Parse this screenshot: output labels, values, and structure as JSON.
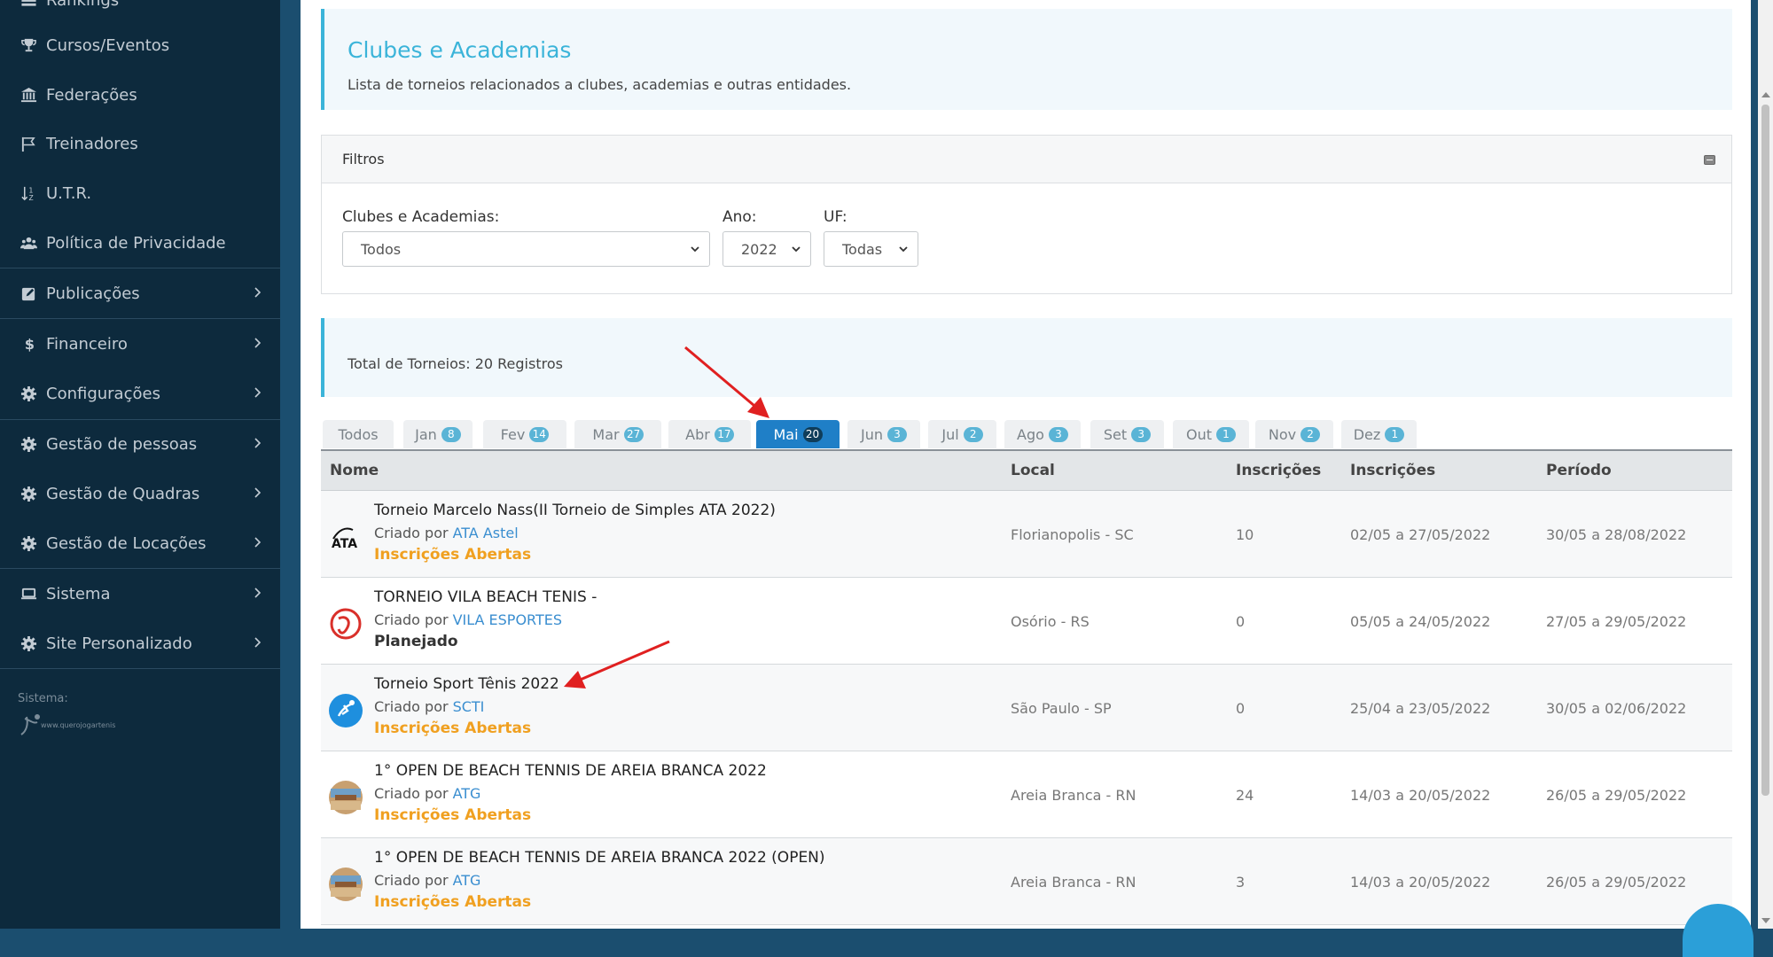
{
  "sidebar": {
    "items": [
      {
        "label": "Rankings",
        "icon": "list-icon"
      },
      {
        "label": "Cursos/Eventos",
        "icon": "trophy-icon"
      },
      {
        "label": "Federações",
        "icon": "bank-icon"
      },
      {
        "label": "Treinadores",
        "icon": "flag-icon"
      },
      {
        "label": "U.T.R.",
        "icon": "sort-icon"
      },
      {
        "label": "Política de Privacidade",
        "icon": "users-icon"
      },
      {
        "label": "Publicações",
        "icon": "edit-icon"
      },
      {
        "label": "Financeiro",
        "icon": "dollar-icon"
      },
      {
        "label": "Configurações",
        "icon": "gear-icon"
      },
      {
        "label": "Gestão de pessoas",
        "icon": "gear-icon"
      },
      {
        "label": "Gestão de Quadras",
        "icon": "gear-icon"
      },
      {
        "label": "Gestão de Locações",
        "icon": "gear-icon"
      },
      {
        "label": "Sistema",
        "icon": "laptop-icon"
      },
      {
        "label": "Site Personalizado",
        "icon": "gear-icon"
      }
    ],
    "system_label": "Sistema:",
    "system_logo_text": "www.querojogartenis.net"
  },
  "header": {
    "title": "Clubes e Academias",
    "subtitle": "Lista de torneios relacionados a clubes, academias e outras entidades."
  },
  "filters": {
    "title": "Filtros",
    "club_label": "Clubes e Academias:",
    "club_value": "Todos",
    "year_label": "Ano:",
    "year_value": "2022",
    "uf_label": "UF:",
    "uf_value": "Todas"
  },
  "total": {
    "text": "Total de Torneios: 20 Registros"
  },
  "tabs": [
    {
      "label": "Todos",
      "count": ""
    },
    {
      "label": "Jan",
      "count": "8"
    },
    {
      "label": "Fev",
      "count": "14"
    },
    {
      "label": "Mar",
      "count": "27"
    },
    {
      "label": "Abr",
      "count": "17"
    },
    {
      "label": "Mai",
      "count": "20"
    },
    {
      "label": "Jun",
      "count": "3"
    },
    {
      "label": "Jul",
      "count": "2"
    },
    {
      "label": "Ago",
      "count": "3"
    },
    {
      "label": "Set",
      "count": "3"
    },
    {
      "label": "Out",
      "count": "1"
    },
    {
      "label": "Nov",
      "count": "2"
    },
    {
      "label": "Dez",
      "count": "1"
    }
  ],
  "table": {
    "headers": {
      "name": "Nome",
      "local": "Local",
      "registrations": "Inscrições",
      "registration_period": "Inscrições",
      "period": "Período"
    },
    "created_prefix": "Criado por",
    "rows": [
      {
        "name": "Torneio Marcelo Nass(II Torneio de Simples ATA 2022)",
        "creator": "ATA Astel",
        "status": "Inscrições Abertas",
        "status_color": "#f0a020",
        "local": "Florianopolis - SC",
        "registrations": "10",
        "registration_period": "02/05 a 27/05/2022",
        "period": "30/05 a 28/08/2022"
      },
      {
        "name": "TORNEIO VILA BEACH TENIS -",
        "creator": "VILA ESPORTES",
        "status": "Planejado",
        "status_color": "#333333",
        "local": "Osório - RS",
        "registrations": "0",
        "registration_period": "05/05 a 24/05/2022",
        "period": "27/05 a 29/05/2022"
      },
      {
        "name": "Torneio Sport Tênis 2022",
        "creator": "SCTI",
        "status": "Inscrições Abertas",
        "status_color": "#f0a020",
        "local": "São Paulo - SP",
        "registrations": "0",
        "registration_period": "25/04 a 23/05/2022",
        "period": "30/05 a 02/06/2022"
      },
      {
        "name": "1° OPEN DE BEACH TENNIS DE AREIA BRANCA 2022",
        "creator": "ATG",
        "status": "Inscrições Abertas",
        "status_color": "#f0a020",
        "local": "Areia Branca - RN",
        "registrations": "24",
        "registration_period": "14/03 a 20/05/2022",
        "period": "26/05 a 29/05/2022"
      },
      {
        "name": "1° OPEN DE BEACH TENNIS DE AREIA BRANCA 2022 (OPEN)",
        "creator": "ATG",
        "status": "Inscrições Abertas",
        "status_color": "#f0a020",
        "local": "Areia Branca - RN",
        "registrations": "3",
        "registration_period": "14/03 a 20/05/2022",
        "period": "26/05 a 29/05/2022"
      }
    ]
  },
  "colors": {
    "accent": "#3bb4d9",
    "active_tab": "#1f7fc7",
    "open_status": "#f0a020",
    "annotation_arrow": "#e02020"
  }
}
